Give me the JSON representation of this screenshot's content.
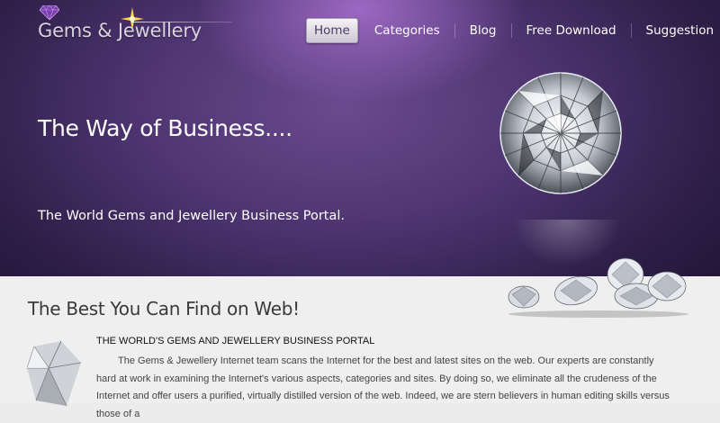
{
  "header": {
    "logo_text": "Gems & Jewellery",
    "nav": [
      {
        "label": "Home",
        "active": true
      },
      {
        "label": "Categories",
        "active": false
      },
      {
        "label": "Blog",
        "active": false
      },
      {
        "label": "Free Download",
        "active": false
      },
      {
        "label": "Suggestion",
        "active": false
      }
    ]
  },
  "hero": {
    "title": "The Way of Business....",
    "subtitle": "The World Gems and Jewellery Business Portal."
  },
  "main": {
    "heading": "The Best You Can Find on Web!",
    "article_heading": "THE WORLD'S GEMS AND JEWELLERY BUSINESS PORTAL",
    "article_body": "The Gems & Jewellery Internet team scans the Internet for the best and latest sites on the web. Our experts are constantly hard at work in examining the Internet's various aspects, categories and sites. By doing so, we eliminate all the crudeness of the Internet and offer users a purified, virtually distilled version of the web. Indeed, we are stern believers in human editing skills versus those of a"
  },
  "colors": {
    "hero_purple": "#4d3470",
    "active_nav_text": "#4a3b62",
    "heading_text": "#3a3a3a"
  },
  "icons": {
    "logo_gem": "purple-gem-icon",
    "logo_star": "sparkle-star-icon"
  }
}
